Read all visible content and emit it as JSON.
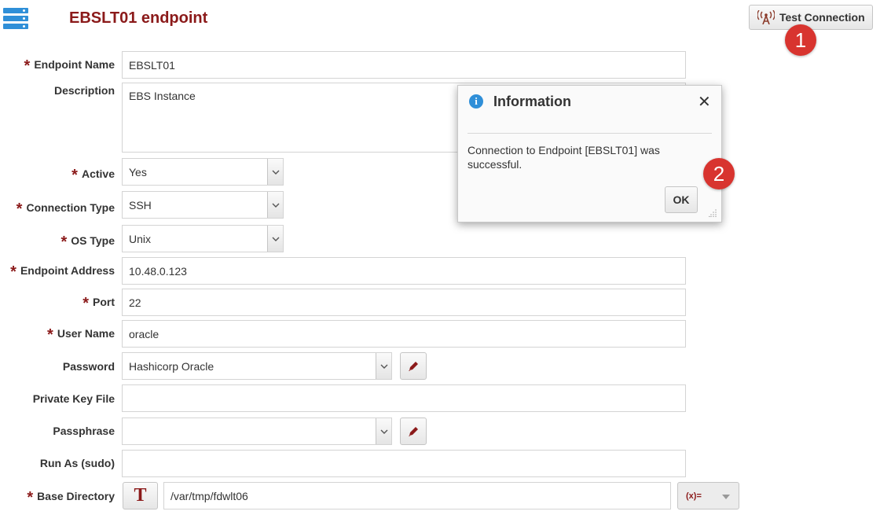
{
  "header": {
    "title": "EBSLT01 endpoint",
    "test_connection_label": "Test Connection"
  },
  "badges": {
    "first": "1",
    "second": "2"
  },
  "form": {
    "endpoint_name": {
      "label": "Endpoint Name",
      "value": "EBSLT01",
      "required": true
    },
    "description": {
      "label": "Description",
      "value": "EBS Instance",
      "required": false
    },
    "active": {
      "label": "Active",
      "value": "Yes",
      "required": true
    },
    "connection_type": {
      "label": "Connection Type",
      "value": "SSH",
      "required": true
    },
    "os_type": {
      "label": "OS Type",
      "value": "Unix",
      "required": true
    },
    "endpoint_address": {
      "label": "Endpoint Address",
      "value": "10.48.0.123",
      "required": true
    },
    "port": {
      "label": "Port",
      "value": "22",
      "required": true
    },
    "user_name": {
      "label": "User Name",
      "value": "oracle",
      "required": true
    },
    "password": {
      "label": "Password",
      "value": "Hashicorp Oracle",
      "required": false
    },
    "private_key_file": {
      "label": "Private Key File",
      "value": "",
      "required": false
    },
    "passphrase": {
      "label": "Passphrase",
      "value": "",
      "required": false
    },
    "run_as": {
      "label": "Run As (sudo)",
      "value": "",
      "required": false
    },
    "base_directory": {
      "label": "Base Directory",
      "value": "/var/tmp/fdwlt06",
      "required": true,
      "type_button_label": "T",
      "expression_label": "(x)="
    }
  },
  "required_marker": "*",
  "dialog": {
    "title": "Information",
    "message": "Connection to Endpoint [EBSLT01] was successful.",
    "ok_label": "OK",
    "close_symbol": "✕"
  },
  "colors": {
    "title": "#8b1a1a",
    "accent": "#2f8fd8",
    "badge": "#d8342f"
  }
}
